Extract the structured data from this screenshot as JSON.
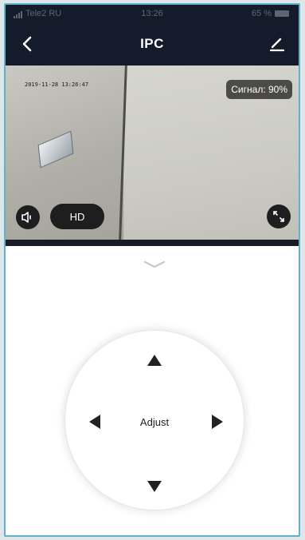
{
  "status_bar": {
    "carrier": "Tele2 RU",
    "time": "13:26",
    "battery": "65 %"
  },
  "nav": {
    "title": "IPC",
    "back_icon": "chevron-left-icon",
    "edit_icon": "pencil-icon"
  },
  "video": {
    "osd_timestamp": "2019-11-28 13:26:47",
    "signal_label": "Сигнал: 90%",
    "hd_label": "HD",
    "sound_icon": "speaker-icon",
    "fullscreen_icon": "fullscreen-icon"
  },
  "panel": {
    "collapse_icon": "chevron-down-icon"
  },
  "ptz": {
    "center_label": "Adjust",
    "arrow_color": "#222222"
  },
  "colors": {
    "header_bg": "#141b2a",
    "frame_border": "#5fb2c8"
  }
}
